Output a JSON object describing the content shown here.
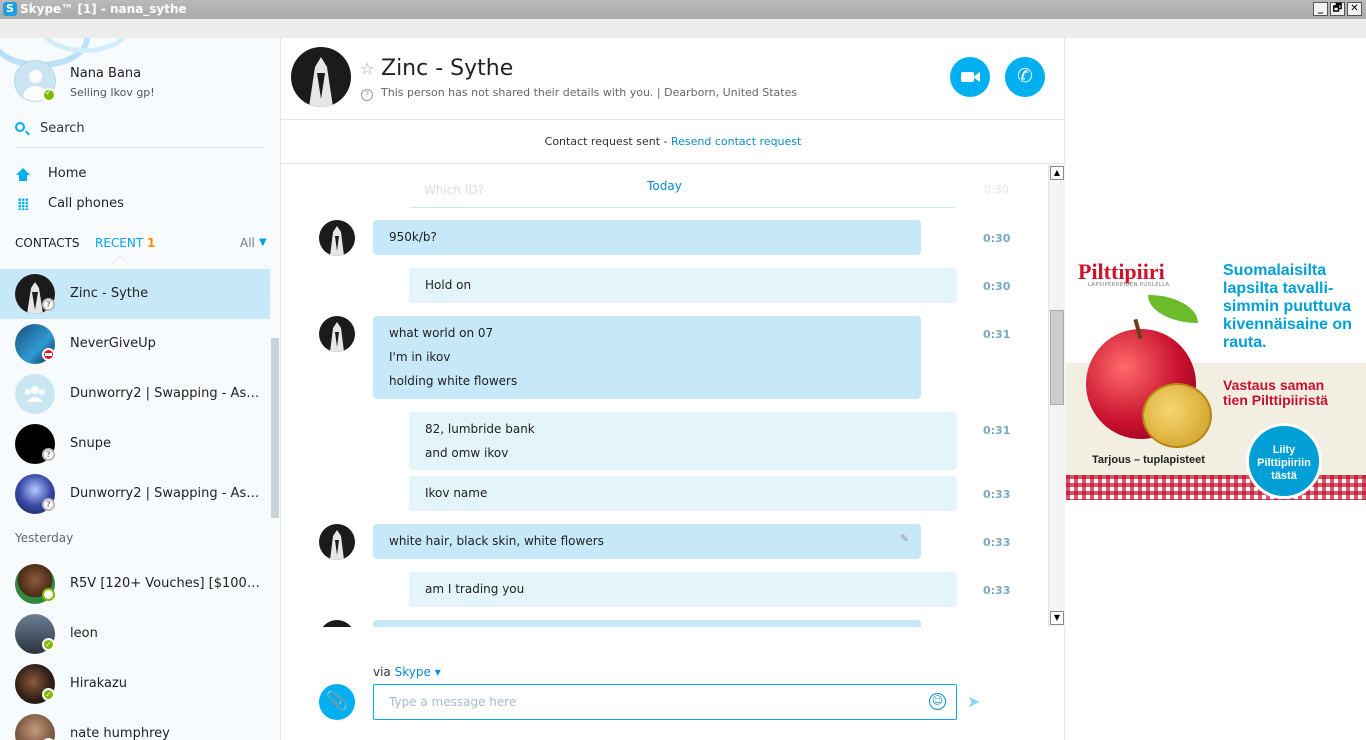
{
  "window": {
    "title": "Skype™ [1] - nana_sythe",
    "controls": [
      "_",
      "🗗",
      "✕"
    ]
  },
  "profile": {
    "name": "Nana Bana",
    "mood": "Selling Ikov gp!"
  },
  "sidebar": {
    "search_label": "Search",
    "nav": [
      {
        "label": "Home",
        "icon": "home-icon"
      },
      {
        "label": "Call phones",
        "icon": "dialpad-icon"
      }
    ],
    "tabs": {
      "contacts": "CONTACTS",
      "recent": "RECENT",
      "recent_count": "1",
      "filter": "All"
    },
    "recent": [
      {
        "name": "Zinc - Sythe",
        "status": "unknown",
        "selected": true
      },
      {
        "name": "NeverGiveUp",
        "status": "dnd"
      },
      {
        "name": "Dunworry2 | Swapping   - Ask...",
        "status": "group"
      },
      {
        "name": "Snupe",
        "status": "unknown"
      },
      {
        "name": "Dunworry2 | Swapping   - Ask...",
        "status": "unknown"
      }
    ],
    "yesterday_label": "Yesterday",
    "yesterday": [
      {
        "name": "R5V [120+ Vouches] [$100 Do...",
        "status": "offline"
      },
      {
        "name": "leon",
        "status": "online"
      },
      {
        "name": "Hirakazu",
        "status": "online"
      },
      {
        "name": "nate humphrey",
        "status": "online"
      }
    ]
  },
  "chat": {
    "name": "Zinc - Sythe",
    "info": "This person has not shared their details with you.  |  Dearborn, United States",
    "request_text": "Contact request sent - ",
    "request_link": "Resend contact request",
    "faded_msg": "Which ID?",
    "faded_time": "0:30",
    "today": "Today",
    "messages": [
      {
        "dir": "in",
        "lines": [
          "950k/b?"
        ],
        "time": "0:30"
      },
      {
        "dir": "out",
        "lines": [
          "Hold on"
        ],
        "time": "0:30"
      },
      {
        "dir": "in",
        "lines": [
          "what world on 07",
          "I'm in ikov",
          "holding white flowers"
        ],
        "time": "0:31"
      },
      {
        "dir": "out",
        "lines": [
          "82, lumbride bank",
          "and omw ikov"
        ],
        "time": "0:31"
      },
      {
        "dir": "out",
        "lines": [
          "Ikov name"
        ],
        "time": "0:33"
      },
      {
        "dir": "in",
        "lines": [
          "white hair, black skin, white flowers"
        ],
        "time": "0:33",
        "edited": true
      },
      {
        "dir": "out",
        "lines": [
          "am I trading you"
        ],
        "time": "0:33"
      }
    ],
    "via_label": "via",
    "via_service": "Skype",
    "input_placeholder": "Type a message here"
  },
  "ad": {
    "brand": "Pilttipiiri",
    "brand_sub": "LAPSIPERHEIDEN PUOLELLA",
    "headline": "Suomalaisilta lapsilta tavalli-simmin puuttuva kivennäisaine on rauta.",
    "answer": "Vastaus saman tien Pilttipiiristä",
    "offer": "Tarjous – tuplapisteet",
    "cta": "Liity Pilttipiiriin tästä"
  }
}
